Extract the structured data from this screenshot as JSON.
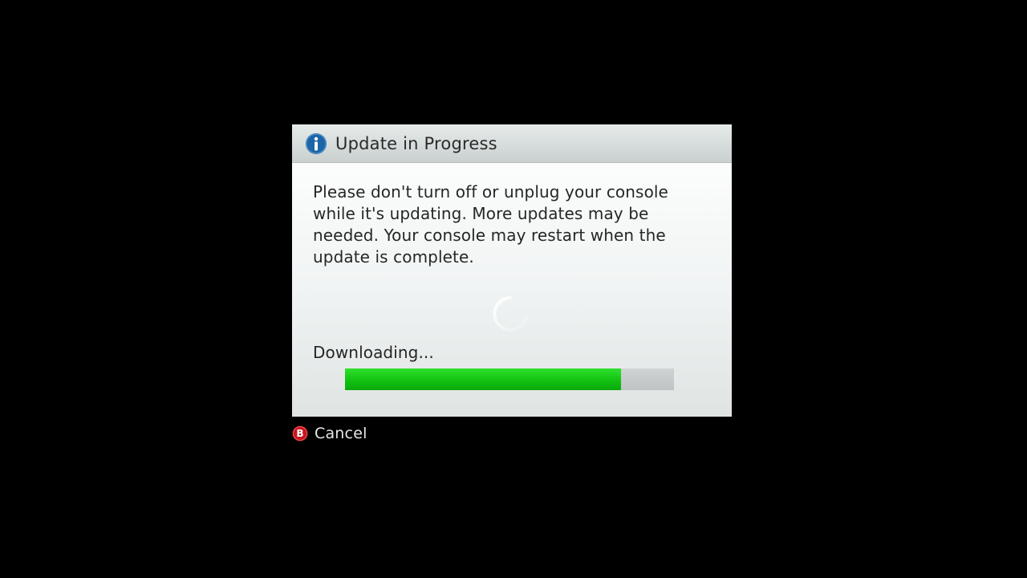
{
  "dialog": {
    "icon": "info-icon",
    "title": "Update in Progress",
    "message": "Please don't turn off or unplug your console while it's updating. More updates may be needed. Your console may restart when the update is complete.",
    "status": "Downloading...",
    "progress_fraction": 0.84
  },
  "controls": {
    "cancel": {
      "button_glyph": "B",
      "label": "Cancel",
      "icon": "b-button-icon"
    }
  },
  "colors": {
    "background": "#000000",
    "info_icon": "#1b65a8",
    "progress_fill": "#18c418",
    "progress_track": "#c4c8c8",
    "b_button": "#c8141e"
  }
}
